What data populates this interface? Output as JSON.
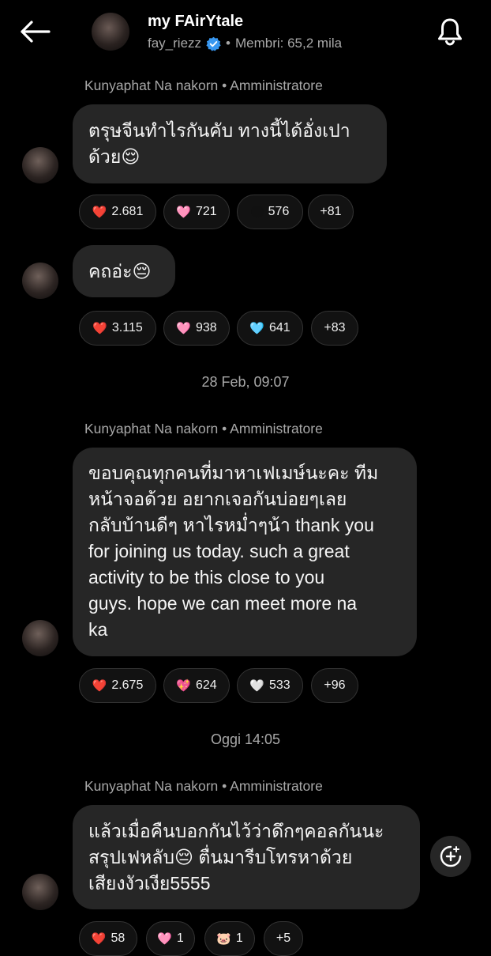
{
  "header": {
    "title": "my FAirYtale",
    "username": "fay_riezz",
    "separator": "•",
    "members": "Membri: 65,2 mila"
  },
  "messages": [
    {
      "sender": "Kunyaphat Na nakorn • Amministratore",
      "lines": [
        "ตรุษจีนทำไรกันคับ ทางนี้ได้อั่งเปา",
        "ด้วย😌"
      ],
      "reactions": [
        {
          "emoji": "❤️",
          "count": "2.681"
        },
        {
          "emoji": "🩷",
          "count": "721"
        },
        {
          "emoji": "",
          "count": "576"
        },
        {
          "emoji": "",
          "count": "+81"
        }
      ]
    },
    {
      "sender": "",
      "lines": [
        "คถอ่ะ😔"
      ],
      "reactions": [
        {
          "emoji": "❤️",
          "count": "3.115"
        },
        {
          "emoji": "🩷",
          "count": "938"
        },
        {
          "emoji": "🩵",
          "count": "641"
        },
        {
          "emoji": "",
          "count": "+83"
        }
      ]
    },
    {
      "timestamp": "28 Feb, 09:07",
      "sender": "Kunyaphat Na nakorn • Amministratore",
      "lines": [
        "ขอบคุณทุกคนที่มาหาเฟเมษ์นะคะ ทีม",
        "หน้าจอด้วย อยากเจอกันบ่อยๆเลย",
        "กลับบ้านดีๆ หาไรหม่ำๆน้า thank you",
        "for joining us today. such a great",
        "activity to be this close to you",
        "guys. hope we can meet more na",
        "ka"
      ],
      "reactions": [
        {
          "emoji": "❤️",
          "count": "2.675"
        },
        {
          "emoji": "💖",
          "count": "624"
        },
        {
          "emoji": "🤍",
          "count": "533"
        },
        {
          "emoji": "",
          "count": "+96"
        }
      ]
    },
    {
      "timestamp": "Oggi 14:05",
      "sender": "Kunyaphat Na nakorn • Amministratore",
      "lines": [
        "แล้วเมื่อคืนบอกกันไว้ว่าดึกๆคอลกันนะ",
        "สรุปเฟหลับ😔 ตื่นมารีบโทรหาด้วย",
        "เสียงงัวเงีย5555"
      ],
      "reactions": [
        {
          "emoji": "❤️",
          "count": "58"
        },
        {
          "emoji": "🩷",
          "count": "1"
        },
        {
          "emoji": "🐷",
          "count": "1"
        },
        {
          "emoji": "",
          "count": "+5"
        }
      ]
    }
  ],
  "icons": {
    "back": "arrow-left-icon",
    "bell": "bell-icon",
    "verified": "verified-badge-icon",
    "add_reaction": "add-reaction-icon"
  },
  "colors": {
    "background": "#000000",
    "bubble": "#262626",
    "verified": "#3897f0",
    "muted_text": "#a8a8a8"
  }
}
